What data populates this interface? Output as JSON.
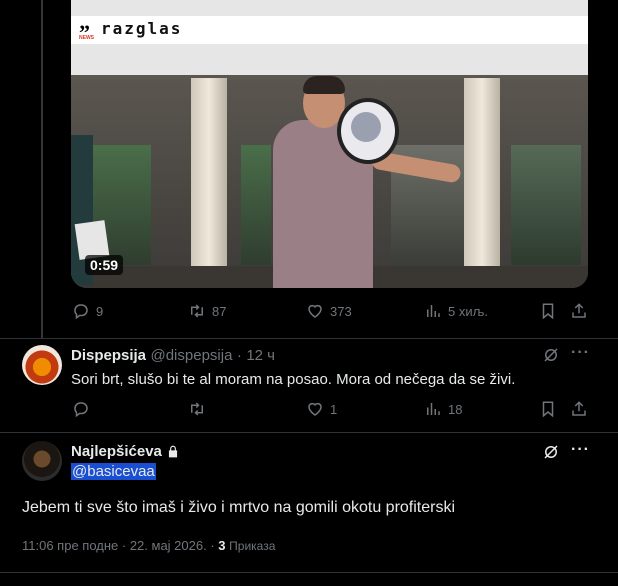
{
  "video": {
    "brand": "razglas",
    "brand_tag": "NEWS",
    "duration": "0:59"
  },
  "tweet1_actions": {
    "replies": "9",
    "retweets": "87",
    "likes": "373",
    "views": "5 хиљ."
  },
  "reply": {
    "display_name": "Dispepsija",
    "handle": "@dispepsija",
    "separator": "·",
    "time": "12 ч",
    "text": "Sori brt, slušo bi te al moram na posao. Mora od nečega da se živi.",
    "actions": {
      "replies": "",
      "retweets": "",
      "likes": "1",
      "views": "18"
    }
  },
  "main_tweet": {
    "display_name": "Najlepšićeva",
    "handle": "@basicevaa",
    "text": "Jebem ti sve što imaš i živo i mrtvo na gomili okotu profiterski",
    "timestamp": "11:06 пре подне · 22. мај 2026. ·",
    "view_count": "3",
    "view_label": "Приказа"
  },
  "colors": {
    "background": "#000000",
    "text": "#e7e9ea",
    "muted": "#71767b",
    "selection": "#1b4fd1"
  }
}
